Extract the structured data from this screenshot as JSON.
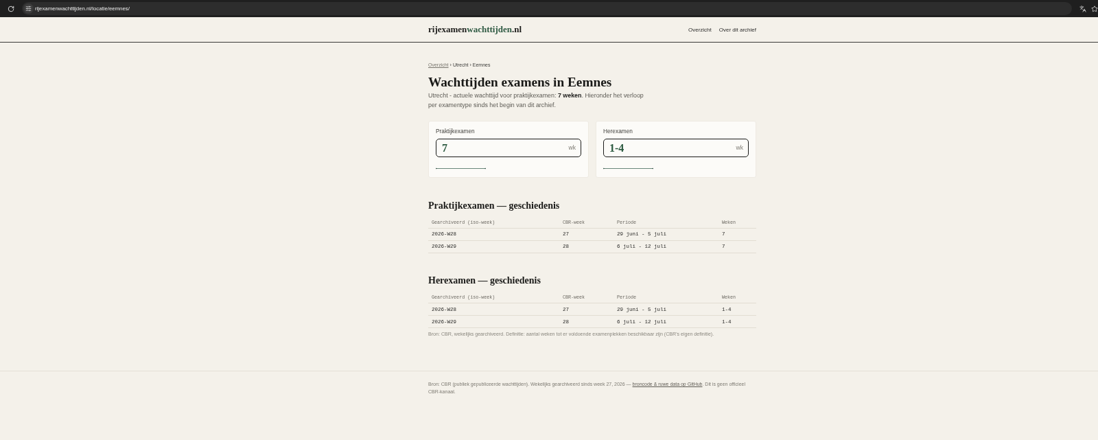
{
  "browser": {
    "url": "rijexamenwachttijden.nl/locatie/eemnes/"
  },
  "header": {
    "logo": [
      {
        "text": "rijexamen",
        "color": "#1c1c1a"
      },
      {
        "text": "wachttijden",
        "color": "#2f5a43"
      },
      {
        "text": ".nl",
        "color": "#1c1c1a"
      }
    ],
    "nav": [
      {
        "label": "Overzicht"
      },
      {
        "label": "Over dit archief"
      }
    ]
  },
  "breadcrumb": [
    {
      "kind": "link",
      "label": "Overzicht"
    },
    {
      "kind": "separator",
      "label": "›"
    },
    {
      "kind": "crumb",
      "label": "Utrecht"
    },
    {
      "kind": "separator",
      "label": "›"
    },
    {
      "kind": "crumb",
      "label": "Eemnes"
    }
  ],
  "title": "Wachttijden examens in Eemnes",
  "intro": "Utrecht - actuele wachttijd voor praktijkexamen: **7 weken**. Hieronder het verloop per examentype sinds het begin van dit archief.",
  "cards": [
    {
      "label": "Praktijkexamen",
      "value": "7",
      "unit": "wk"
    },
    {
      "label": "Herexamen",
      "value": "1-4",
      "unit": "wk"
    }
  ],
  "sections": [
    {
      "title": "Praktijkexamen — geschiedenis",
      "columns": [
        "Gearchiveerd (iso-week)",
        "CBR-week",
        "Periode",
        "Weken"
      ],
      "rows": [
        [
          "2026-W28",
          "27",
          "29 juni - 5 juli",
          "7"
        ],
        [
          "2026-W29",
          "28",
          "6 juli - 12 juli",
          "7"
        ]
      ]
    },
    {
      "title": "Herexamen — geschiedenis",
      "columns": [
        "Gearchiveerd (iso-week)",
        "CBR-week",
        "Periode",
        "Weken"
      ],
      "rows": [
        [
          "2026-W28",
          "27",
          "29 juni - 5 juli",
          "1-4"
        ],
        [
          "2026-W29",
          "28",
          "6 juli - 12 juli",
          "1-4"
        ]
      ],
      "note": "Bron: CBR, wekelijks gearchiveerd. Definitie: aantal weken tot er voldoende examenplekken beschikbaar zijn (CBR's eigen definitie)."
    }
  ],
  "footer": {
    "text_before": "Bron: CBR (publiek gepubliceerde wachttijden). Wekelijks gearchiveerd sinds week 27, 2026 — ",
    "link": "broncode & ruwe data op GitHub",
    "text_after": ". Dit is geen officieel CBR-kanaal."
  }
}
